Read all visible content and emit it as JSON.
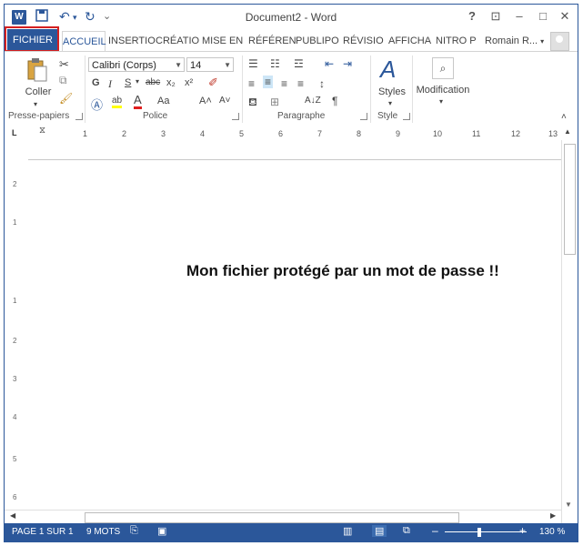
{
  "window": {
    "title": "Document2 - Word",
    "help": "?",
    "restore_ribbon": "⊡",
    "minimize": "–",
    "maximize": "□",
    "close": "✕"
  },
  "qat": {
    "logo": "W",
    "save": "💾",
    "undo": "↶",
    "redo": "↻",
    "customize": "⌄"
  },
  "tabs": {
    "file": "FICHIER",
    "home": "ACCUEIL",
    "insert": "INSERTIO",
    "design": "CRÉATIO",
    "layout": "MISE EN",
    "references": "RÉFÉREN",
    "mailings": "PUBLIPO",
    "review": "RÉVISIO",
    "view": "AFFICHA",
    "nitro": "NITRO P",
    "user": "Romain R...",
    "user_arrow": "▾"
  },
  "ribbon": {
    "clipboard": {
      "paste": "Coller",
      "label": "Presse-papiers"
    },
    "font": {
      "name": "Calibri (Corps)",
      "size": "14",
      "bold": "G",
      "italic": "I",
      "underline": "S",
      "strike": "abc",
      "subscript": "x₂",
      "superscript": "x²",
      "grow": "A˄",
      "shrink": "A˅",
      "case": "Aa",
      "label": "Police"
    },
    "paragraph": {
      "label": "Paragraphe",
      "sort": "A↓Z",
      "pilcrow": "¶"
    },
    "styles": {
      "button": "Styles",
      "label": "Style"
    },
    "editing": {
      "button": "Modification"
    }
  },
  "ruler": {
    "marks": [
      "1",
      "2",
      "3",
      "4",
      "5",
      "6",
      "7",
      "8",
      "9",
      "10",
      "11",
      "12",
      "13"
    ]
  },
  "vruler": {
    "marks": [
      "2",
      "1",
      "1",
      "2",
      "3",
      "4",
      "5",
      "6"
    ]
  },
  "document": {
    "text": "Mon fichier protégé par un mot de passe !!"
  },
  "status": {
    "page": "PAGE 1 SUR 1",
    "words": "9 MOTS",
    "minus": "–",
    "plus": "+",
    "zoom": "130 %"
  },
  "colors": {
    "accent": "#2b579a",
    "highlight_outline": "#d42020"
  }
}
